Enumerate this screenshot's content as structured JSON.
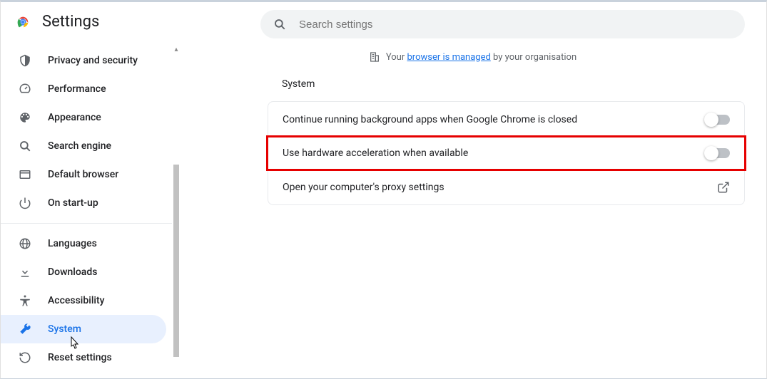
{
  "header": {
    "title": "Settings",
    "search_placeholder": "Search settings"
  },
  "managed_notice": {
    "prefix": "Your ",
    "link": "browser is managed",
    "suffix": " by your organisation"
  },
  "sidebar": {
    "items": [
      {
        "label": "Privacy and security",
        "icon": "shield-icon"
      },
      {
        "label": "Performance",
        "icon": "speedometer-icon"
      },
      {
        "label": "Appearance",
        "icon": "palette-icon"
      },
      {
        "label": "Search engine",
        "icon": "search-icon"
      },
      {
        "label": "Default browser",
        "icon": "browser-icon"
      },
      {
        "label": "On start-up",
        "icon": "power-icon"
      },
      {
        "label": "Languages",
        "icon": "globe-icon"
      },
      {
        "label": "Downloads",
        "icon": "download-icon"
      },
      {
        "label": "Accessibility",
        "icon": "accessibility-icon"
      },
      {
        "label": "System",
        "icon": "wrench-icon"
      },
      {
        "label": "Reset settings",
        "icon": "reset-icon"
      }
    ],
    "active_index": 9
  },
  "section": {
    "title": "System",
    "rows": [
      {
        "label": "Continue running background apps when Google Chrome is closed",
        "type": "toggle",
        "value": false
      },
      {
        "label": "Use hardware acceleration when available",
        "type": "toggle",
        "value": false,
        "highlighted": true
      },
      {
        "label": "Open your computer's proxy settings",
        "type": "link"
      }
    ]
  }
}
